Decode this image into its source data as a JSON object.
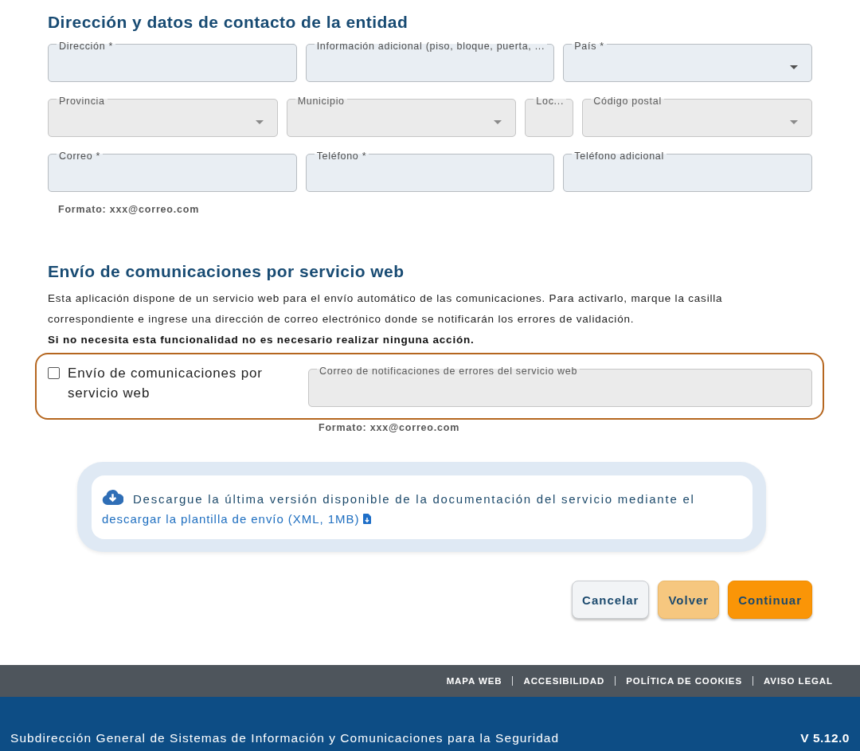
{
  "address_section": {
    "title": "Dirección y datos de contacto de la entidad",
    "rows": [
      {
        "fields": [
          {
            "label": "Dirección *",
            "kind": "text",
            "disabled": false
          },
          {
            "label": "Información adicional (piso, bloque, puerta, ...",
            "kind": "text",
            "disabled": false
          },
          {
            "label": "País *",
            "kind": "select",
            "disabled": false
          }
        ]
      },
      {
        "fields": [
          {
            "label": "Provincia",
            "kind": "select",
            "disabled": true
          },
          {
            "label": "Municipio",
            "kind": "select",
            "disabled": true
          },
          {
            "label": "Loc...",
            "kind": "text",
            "disabled": true
          },
          {
            "label": "Código postal",
            "kind": "select",
            "disabled": true
          }
        ]
      },
      {
        "fields": [
          {
            "label": "Correo *",
            "kind": "text",
            "disabled": false
          },
          {
            "label": "Teléfono *",
            "kind": "text",
            "disabled": false
          },
          {
            "label": "Teléfono adicional",
            "kind": "text",
            "disabled": false
          }
        ]
      }
    ],
    "hint": "Formato: xxx@correo.com"
  },
  "webservice_section": {
    "title": "Envío de comunicaciones por servicio web",
    "description": "Esta aplicación dispone de un servicio web para el envío automático de las comunicaciones. Para activarlo, marque la casilla correspondiente e ingrese una dirección de correo electrónico donde se notificarán los errores de validación.",
    "note": "Si no necesita esta funcionalidad no es necesario realizar ninguna acción.",
    "checkbox": {
      "label": "Envío de comunicaciones por servicio web",
      "checked": false
    },
    "email_field": {
      "label": "Correo de notificaciones de errores del servicio web",
      "disabled": true
    },
    "hint": "Formato: xxx@correo.com"
  },
  "download_panel": {
    "text": "Descargue la última versión disponible de la documentación del servicio mediante el",
    "link": "descargar la plantilla de envío (XML, 1MB)"
  },
  "buttons": [
    {
      "label": "Cancelar",
      "kind": "cancel"
    },
    {
      "label": "Volver",
      "kind": "back"
    },
    {
      "label": "Continuar",
      "kind": "primary"
    }
  ],
  "footer": {
    "links": [
      "MAPA WEB",
      "ACCESIBILIDAD",
      "POLÍTICA DE COOKIES",
      "AVISO LEGAL"
    ],
    "organization": "Subdirección General de Sistemas de Información y Comunicaciones para la Seguridad",
    "version": "V 5.12.0"
  }
}
